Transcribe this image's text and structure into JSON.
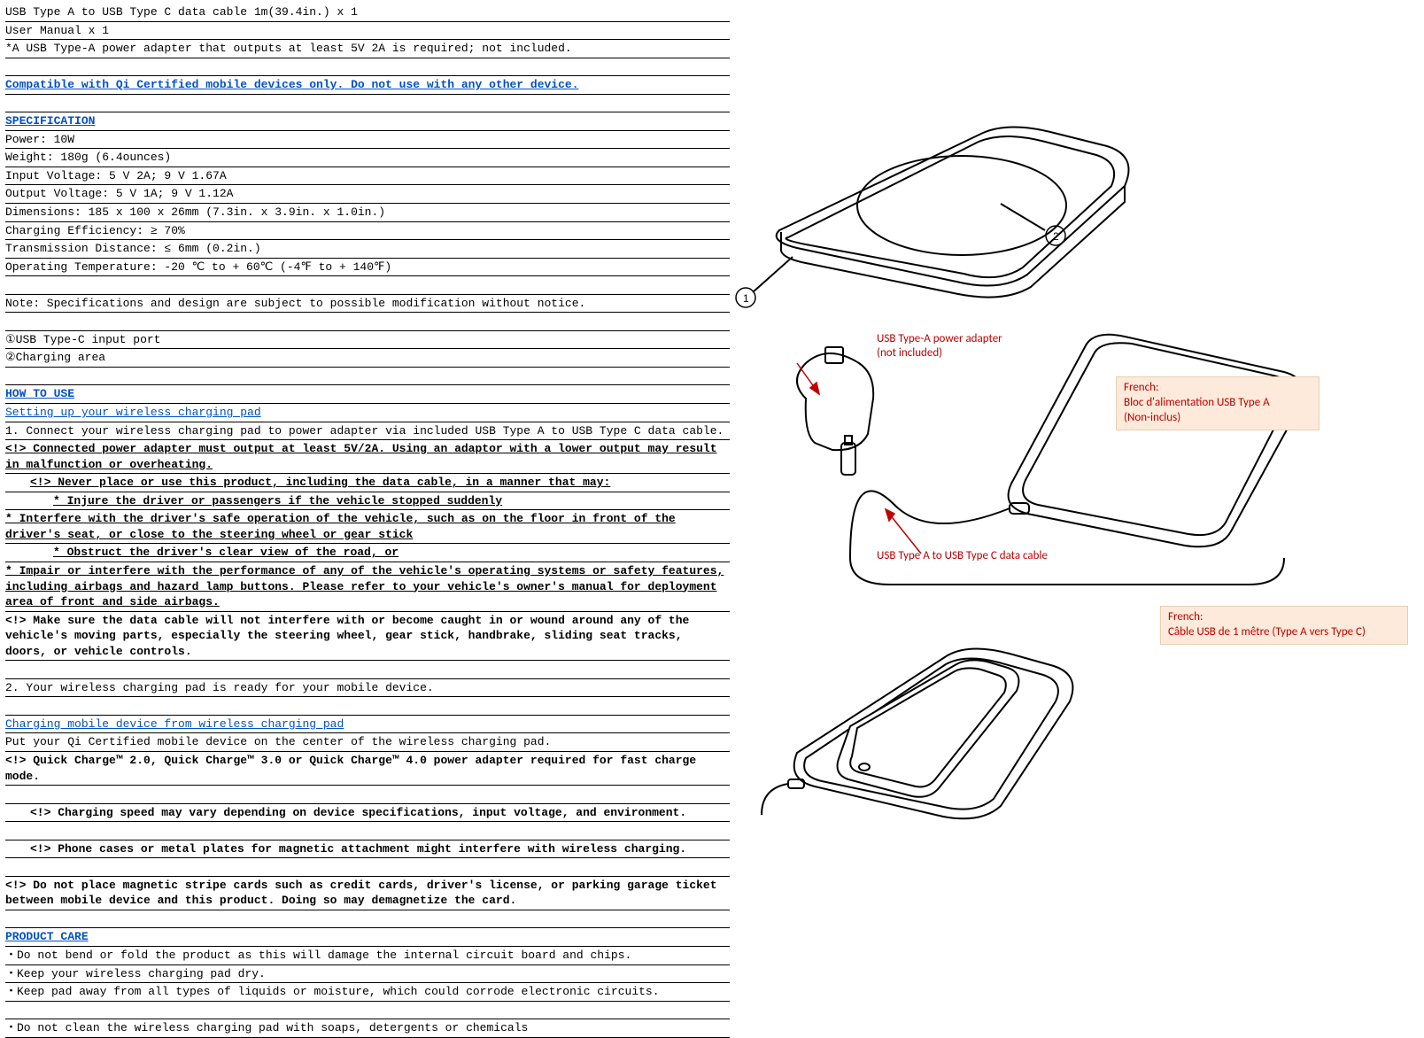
{
  "left": {
    "contents": [
      "USB Type A to USB Type C data cable 1m(39.4in.) x 1",
      "User Manual x 1",
      "*A USB Type-A power adapter that outputs at least 5V 2A is required; not included."
    ],
    "compat": "Compatible with Qi Certified mobile devices only.  Do not use with any other device.",
    "spec_head": "SPECIFICATION",
    "spec": {
      "power": "Power:               10W",
      "weight": "Weight:              180g (6.4ounces)",
      "input": "Input Voltage:     5 V 2A; 9 V 1.67A",
      "output": "Output Voltage:   5 V 1A; 9 V 1.12A",
      "dims": "Dimensions:         185 x 100 x 26mm (7.3in. x 3.9in. x 1.0in.)",
      "eff": "Charging Efficiency:      ≥ 70%",
      "trans": "Transmission Distance: ≤ 6mm (0.2in.)",
      "temp": "Operating Temperature: -20 ℃ to + 60℃ (-4℉ to + 140℉)"
    },
    "note": "Note: Specifications and design are subject to possible modification without notice.",
    "port1": "①USB Type-C input port",
    "port2": "②Charging area",
    "howto_head": "HOW TO USE",
    "setup_head": "Setting up your wireless charging pad",
    "step1": "1. Connect your wireless charging pad to power adapter via included USB Type A to USB Type C data cable.",
    "warn_adapter": "<!> Connected power adapter must output at least 5V/2A. Using an adaptor with a lower output may result in malfunction or overheating.",
    "warn_never": "<!> Never place or use this product, including the data cable, in a manner that may:",
    "bullet_injure": "* Injure the driver or passengers if the vehicle stopped suddenly",
    "bullet_interfere": "* Interfere with the driver's safe operation of the vehicle, such as on the floor in front of the driver's seat, or close to the steering wheel or gear stick",
    "bullet_obstruct": "* Obstruct the driver's clear view of the road, or",
    "bullet_impair": "* Impair or interfere with the performance of any of the vehicle's operating systems or safety features, including airbags and hazard lamp buttons.  Please refer to your vehicle's owner's manual for deployment area of front and side airbags.",
    "warn_cable": "<!> Make sure the data cable will not interfere with or become caught in or wound around any of the vehicle's moving parts, especially the steering wheel, gear stick, handbrake, sliding seat tracks, doors, or vehicle controls.",
    "step2": "2. Your wireless charging pad is ready for your mobile device.",
    "charge_head": "Charging mobile device from wireless charging pad",
    "charge_put": "Put your Qi Certified mobile device on the center of the wireless charging pad.",
    "warn_qc": "<!> Quick Charge™ 2.0, Quick Charge™ 3.0 or Quick Charge™ 4.0 power adapter required for fast charge mode.",
    "warn_speed": "<!> Charging speed may vary depending on device specifications, input voltage, and environment.",
    "warn_case": "<!> Phone cases or metal plates for magnetic attachment might interfere with wireless charging.",
    "warn_mag": "<!> Do not place magnetic stripe cards such as credit cards, driver's license, or parking garage ticket between mobile device and this product.  Doing so may demagnetize the card.",
    "care_head": "PRODUCT CARE",
    "care": [
      "・Do not bend or fold the product as this will damage the internal circuit board and chips.",
      "・Keep your wireless charging pad dry.",
      "・Keep pad away from all types of liquids or moisture, which could corrode electronic circuits.",
      "・Do not clean the wireless charging pad with soaps, detergents or chemicals"
    ]
  },
  "right": {
    "label_adapter": "USB Type-A power adapter\n(not included)",
    "label_cable": "USB Type A to USB Type C data cable",
    "callout_adapter_head": "French:",
    "callout_adapter_body": "Bloc d'alimentation USB Type A\n(Non-inclus)",
    "callout_cable_head": "French:",
    "callout_cable_body": "Câble USB de 1 mêtre (Type A vers Type C)"
  }
}
